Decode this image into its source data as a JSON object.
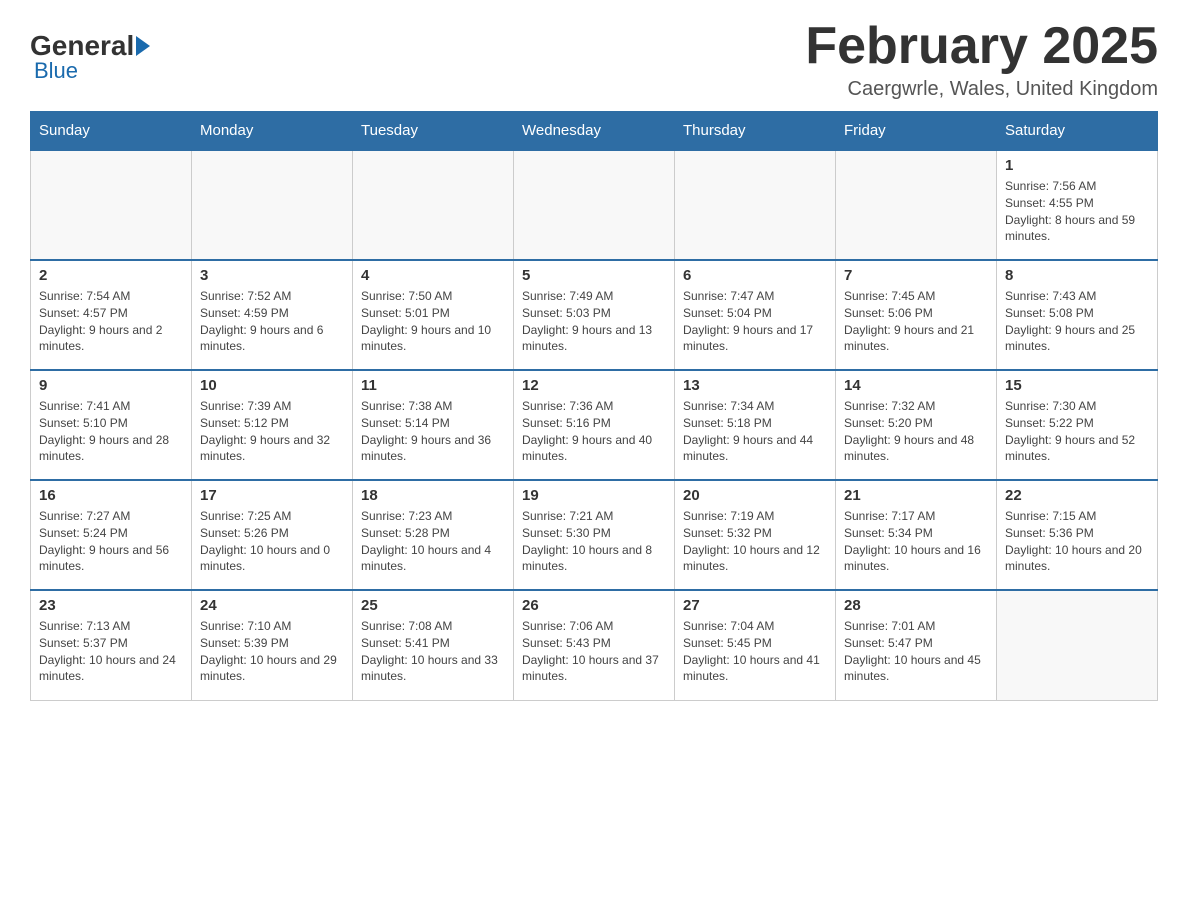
{
  "logo": {
    "general": "General",
    "blue": "Blue"
  },
  "title": "February 2025",
  "location": "Caergwrle, Wales, United Kingdom",
  "days_of_week": [
    "Sunday",
    "Monday",
    "Tuesday",
    "Wednesday",
    "Thursday",
    "Friday",
    "Saturday"
  ],
  "weeks": [
    [
      {
        "day": "",
        "info": ""
      },
      {
        "day": "",
        "info": ""
      },
      {
        "day": "",
        "info": ""
      },
      {
        "day": "",
        "info": ""
      },
      {
        "day": "",
        "info": ""
      },
      {
        "day": "",
        "info": ""
      },
      {
        "day": "1",
        "info": "Sunrise: 7:56 AM\nSunset: 4:55 PM\nDaylight: 8 hours and 59 minutes."
      }
    ],
    [
      {
        "day": "2",
        "info": "Sunrise: 7:54 AM\nSunset: 4:57 PM\nDaylight: 9 hours and 2 minutes."
      },
      {
        "day": "3",
        "info": "Sunrise: 7:52 AM\nSunset: 4:59 PM\nDaylight: 9 hours and 6 minutes."
      },
      {
        "day": "4",
        "info": "Sunrise: 7:50 AM\nSunset: 5:01 PM\nDaylight: 9 hours and 10 minutes."
      },
      {
        "day": "5",
        "info": "Sunrise: 7:49 AM\nSunset: 5:03 PM\nDaylight: 9 hours and 13 minutes."
      },
      {
        "day": "6",
        "info": "Sunrise: 7:47 AM\nSunset: 5:04 PM\nDaylight: 9 hours and 17 minutes."
      },
      {
        "day": "7",
        "info": "Sunrise: 7:45 AM\nSunset: 5:06 PM\nDaylight: 9 hours and 21 minutes."
      },
      {
        "day": "8",
        "info": "Sunrise: 7:43 AM\nSunset: 5:08 PM\nDaylight: 9 hours and 25 minutes."
      }
    ],
    [
      {
        "day": "9",
        "info": "Sunrise: 7:41 AM\nSunset: 5:10 PM\nDaylight: 9 hours and 28 minutes."
      },
      {
        "day": "10",
        "info": "Sunrise: 7:39 AM\nSunset: 5:12 PM\nDaylight: 9 hours and 32 minutes."
      },
      {
        "day": "11",
        "info": "Sunrise: 7:38 AM\nSunset: 5:14 PM\nDaylight: 9 hours and 36 minutes."
      },
      {
        "day": "12",
        "info": "Sunrise: 7:36 AM\nSunset: 5:16 PM\nDaylight: 9 hours and 40 minutes."
      },
      {
        "day": "13",
        "info": "Sunrise: 7:34 AM\nSunset: 5:18 PM\nDaylight: 9 hours and 44 minutes."
      },
      {
        "day": "14",
        "info": "Sunrise: 7:32 AM\nSunset: 5:20 PM\nDaylight: 9 hours and 48 minutes."
      },
      {
        "day": "15",
        "info": "Sunrise: 7:30 AM\nSunset: 5:22 PM\nDaylight: 9 hours and 52 minutes."
      }
    ],
    [
      {
        "day": "16",
        "info": "Sunrise: 7:27 AM\nSunset: 5:24 PM\nDaylight: 9 hours and 56 minutes."
      },
      {
        "day": "17",
        "info": "Sunrise: 7:25 AM\nSunset: 5:26 PM\nDaylight: 10 hours and 0 minutes."
      },
      {
        "day": "18",
        "info": "Sunrise: 7:23 AM\nSunset: 5:28 PM\nDaylight: 10 hours and 4 minutes."
      },
      {
        "day": "19",
        "info": "Sunrise: 7:21 AM\nSunset: 5:30 PM\nDaylight: 10 hours and 8 minutes."
      },
      {
        "day": "20",
        "info": "Sunrise: 7:19 AM\nSunset: 5:32 PM\nDaylight: 10 hours and 12 minutes."
      },
      {
        "day": "21",
        "info": "Sunrise: 7:17 AM\nSunset: 5:34 PM\nDaylight: 10 hours and 16 minutes."
      },
      {
        "day": "22",
        "info": "Sunrise: 7:15 AM\nSunset: 5:36 PM\nDaylight: 10 hours and 20 minutes."
      }
    ],
    [
      {
        "day": "23",
        "info": "Sunrise: 7:13 AM\nSunset: 5:37 PM\nDaylight: 10 hours and 24 minutes."
      },
      {
        "day": "24",
        "info": "Sunrise: 7:10 AM\nSunset: 5:39 PM\nDaylight: 10 hours and 29 minutes."
      },
      {
        "day": "25",
        "info": "Sunrise: 7:08 AM\nSunset: 5:41 PM\nDaylight: 10 hours and 33 minutes."
      },
      {
        "day": "26",
        "info": "Sunrise: 7:06 AM\nSunset: 5:43 PM\nDaylight: 10 hours and 37 minutes."
      },
      {
        "day": "27",
        "info": "Sunrise: 7:04 AM\nSunset: 5:45 PM\nDaylight: 10 hours and 41 minutes."
      },
      {
        "day": "28",
        "info": "Sunrise: 7:01 AM\nSunset: 5:47 PM\nDaylight: 10 hours and 45 minutes."
      },
      {
        "day": "",
        "info": ""
      }
    ]
  ]
}
